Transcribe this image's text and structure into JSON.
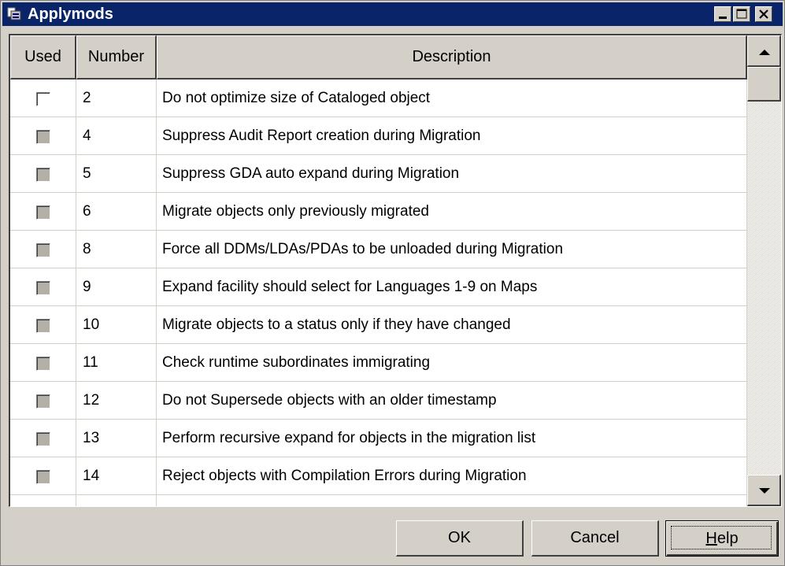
{
  "window": {
    "title": "Applymods",
    "title_color": "#0a246a",
    "app_icon": "applymods-window-icon",
    "caption_buttons": [
      "minimize-icon",
      "maximize-icon",
      "close-icon"
    ]
  },
  "table": {
    "columns": {
      "used": "Used",
      "number": "Number",
      "description": "Description"
    },
    "rows": [
      {
        "used": false,
        "style": "white",
        "number": "2",
        "description": "Do not optimize size of Cataloged object"
      },
      {
        "used": false,
        "style": "grey",
        "number": "4",
        "description": "Suppress Audit Report creation during Migration"
      },
      {
        "used": false,
        "style": "grey",
        "number": "5",
        "description": "Suppress GDA auto expand during Migration"
      },
      {
        "used": false,
        "style": "grey",
        "number": "6",
        "description": "Migrate objects only previously migrated"
      },
      {
        "used": false,
        "style": "grey",
        "number": "8",
        "description": "Force all DDMs/LDAs/PDAs to be unloaded during Migration"
      },
      {
        "used": false,
        "style": "grey",
        "number": "9",
        "description": "Expand facility should select for Languages 1-9 on Maps"
      },
      {
        "used": false,
        "style": "grey",
        "number": "10",
        "description": "Migrate objects to a status only if they have changed"
      },
      {
        "used": false,
        "style": "grey",
        "number": "11",
        "description": "Check runtime subordinates immigrating"
      },
      {
        "used": false,
        "style": "grey",
        "number": "12",
        "description": "Do not Supersede objects with an older timestamp"
      },
      {
        "used": false,
        "style": "grey",
        "number": "13",
        "description": "Perform recursive expand for objects in the migration list"
      },
      {
        "used": false,
        "style": "grey",
        "number": "14",
        "description": "Reject objects with Compilation Errors during Migration"
      }
    ]
  },
  "scrollbar": {
    "up_icon": "scroll-up-arrow-icon",
    "down_icon": "scroll-down-arrow-icon"
  },
  "buttons": {
    "ok": "OK",
    "cancel": "Cancel",
    "help_mnemonic": "H",
    "help_rest": "elp"
  }
}
